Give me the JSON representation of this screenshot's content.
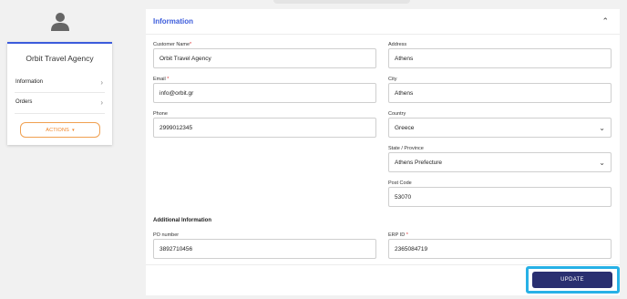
{
  "customer": {
    "name": "Orbit Travel Agency",
    "menu": [
      {
        "label": "Information"
      },
      {
        "label": "Orders"
      }
    ],
    "actions_label": "ACTIONS"
  },
  "panel": {
    "title": "Information",
    "fields": {
      "customer_name": {
        "label": "Customer Name",
        "required": "*",
        "value": "Orbit Travel Agency"
      },
      "address": {
        "label": "Address",
        "value": "Athens"
      },
      "email": {
        "label": "Email",
        "required": "*",
        "value": "info@orbit.gr"
      },
      "city": {
        "label": "City",
        "value": "Athens"
      },
      "phone": {
        "label": "Phone",
        "value": "2999012345"
      },
      "country": {
        "label": "Country",
        "value": "Greece"
      },
      "state": {
        "label": "State / Province",
        "value": "Athens Prefecture"
      },
      "post_code": {
        "label": "Post Code",
        "value": "53070"
      },
      "po_number": {
        "label": "PO number",
        "value": "3892710456"
      },
      "erp_id": {
        "label": "ERP ID",
        "required": "*",
        "value": "2365084719"
      }
    },
    "additional_title": "Additional Information",
    "update_label": "UPDATE"
  },
  "icons": {
    "avatar": "user-icon",
    "chevron_right": "chevron-right-icon",
    "collapse": "chevron-up-icon",
    "select": "chevron-down-icon"
  },
  "colors": {
    "accent_blue": "#3b5bdb",
    "actions_orange": "#f08020",
    "update_button": "#2a2f70",
    "highlight": "#27b1e6"
  }
}
